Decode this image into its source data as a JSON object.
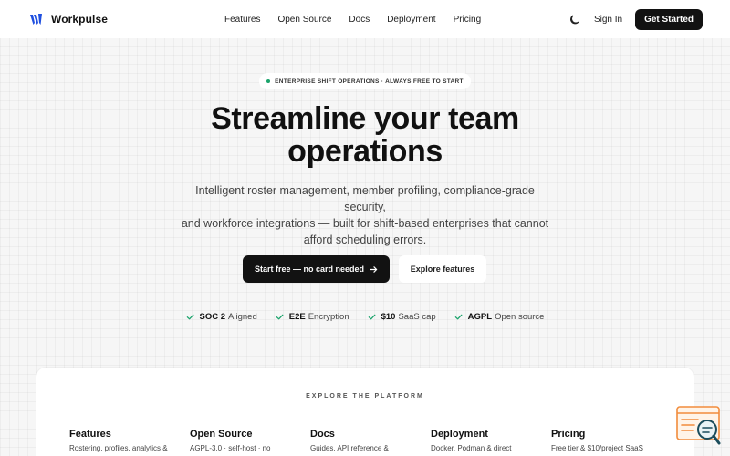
{
  "brand": {
    "name": "Workpulse",
    "accent": "#1f4fe0"
  },
  "nav": {
    "links": [
      "Features",
      "Open Source",
      "Docs",
      "Deployment",
      "Pricing"
    ],
    "theme_icon": "moon-icon",
    "signin_label": "Sign In",
    "cta_label": "Get Started"
  },
  "hero": {
    "pill_text": "ENTERPRISE SHIFT OPERATIONS · ALWAYS FREE TO START",
    "headline_line1": "Streamline your team",
    "headline_line2": "operations",
    "sub_line1": "Intelligent roster management, member profiling, compliance-grade security,",
    "sub_line2": "and workforce integrations — built for shift-based enterprises that cannot",
    "sub_line3": "afford scheduling errors.",
    "primary_cta": "Start free — no card needed",
    "secondary_cta": "Explore features"
  },
  "badges": [
    {
      "strong": "SOC 2",
      "text": "Aligned"
    },
    {
      "strong": "E2E",
      "text": "Encryption"
    },
    {
      "strong": "$10",
      "text": "SaaS cap"
    },
    {
      "strong": "AGPL",
      "text": "Open source"
    }
  ],
  "platform": {
    "label": "EXPLORE THE PLATFORM",
    "columns": [
      {
        "title": "Features",
        "desc": "Rostering, profiles, analytics &"
      },
      {
        "title": "Open Source",
        "desc": "AGPL-3.0 · self-host · no"
      },
      {
        "title": "Docs",
        "desc": "Guides, API reference &"
      },
      {
        "title": "Deployment",
        "desc": "Docker, Podman & direct"
      },
      {
        "title": "Pricing",
        "desc": "Free tier & $10/project SaaS"
      }
    ]
  },
  "colors": {
    "dark": "#121212",
    "check": "#1aa36b",
    "widget": "#f28c3c",
    "widget_dark": "#1b4d5c"
  }
}
